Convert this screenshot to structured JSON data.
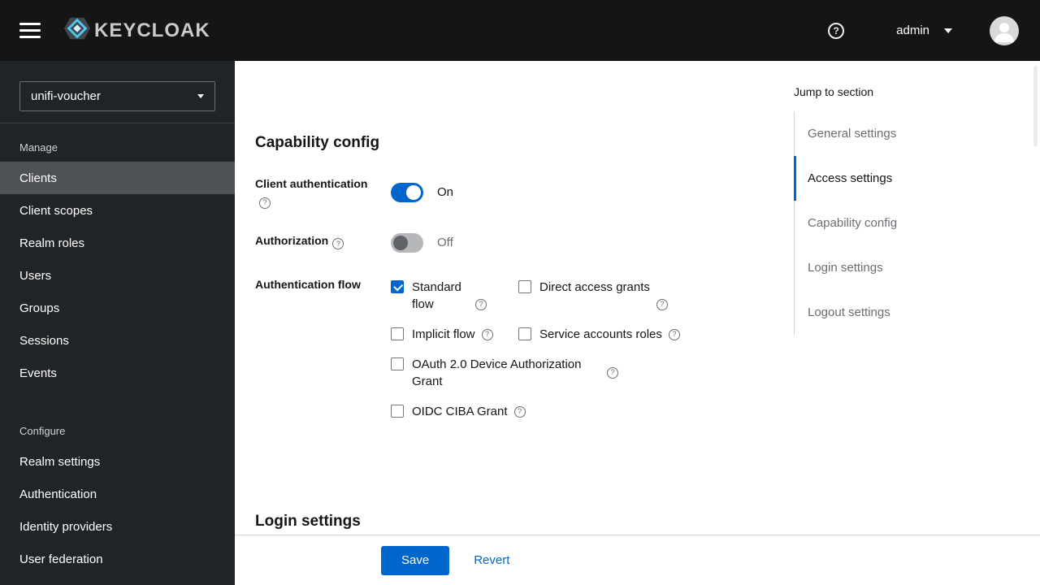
{
  "header": {
    "brand": "KEYCLOAK",
    "user_menu": "admin"
  },
  "icons": {
    "nav_toggle": "hamburger-menu",
    "brand_mark": "keycloak-shield",
    "help": "question-circle",
    "user_caret": "caret-down",
    "avatar": "user-silhouette",
    "realm_caret": "caret-down",
    "field_help": "question-circle-outline"
  },
  "sidebar": {
    "realm_selector": "unifi-voucher",
    "manage_title": "Manage",
    "manage_items": [
      "Clients",
      "Client scopes",
      "Realm roles",
      "Users",
      "Groups",
      "Sessions",
      "Events"
    ],
    "active_item": "Clients",
    "configure_title": "Configure",
    "configure_items": [
      "Realm settings",
      "Authentication",
      "Identity providers",
      "User federation"
    ]
  },
  "capability_config": {
    "title": "Capability config",
    "client_authentication": {
      "label": "Client authentication",
      "state": "On",
      "enabled": true
    },
    "authorization": {
      "label": "Authorization",
      "state": "Off",
      "enabled": false
    },
    "authentication_flow": {
      "label": "Authentication flow",
      "options": [
        {
          "label": "Standard flow",
          "checked": true
        },
        {
          "label": "Direct access grants",
          "checked": false
        },
        {
          "label": "Implicit flow",
          "checked": false
        },
        {
          "label": "Service accounts roles",
          "checked": false
        },
        {
          "label": "OAuth 2.0 Device Authorization Grant",
          "checked": false
        },
        {
          "label": "OIDC CIBA Grant",
          "checked": false
        }
      ]
    }
  },
  "login_settings": {
    "title": "Login settings"
  },
  "actions": {
    "save": "Save",
    "revert": "Revert"
  },
  "jump_to_section": {
    "title": "Jump to section",
    "items": [
      {
        "label": "General settings",
        "active": false
      },
      {
        "label": "Access settings",
        "active": true
      },
      {
        "label": "Capability config",
        "active": false
      },
      {
        "label": "Login settings",
        "active": false
      },
      {
        "label": "Logout settings",
        "active": false
      }
    ]
  },
  "colors": {
    "primary": "#0066cc",
    "header_bg": "#151515",
    "sidebar_bg": "#212427",
    "sidebar_active_bg": "#4f5255",
    "toggle_off_track": "#b5b7b9",
    "jump_border": "#d2d2d2"
  }
}
